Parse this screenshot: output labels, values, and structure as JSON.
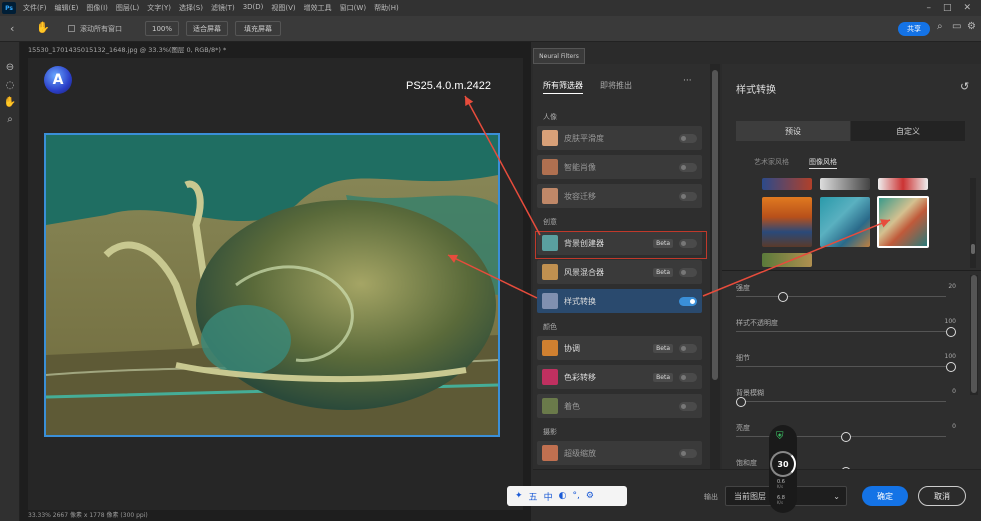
{
  "menu": {
    "ps_icon": "Ps",
    "items": [
      "文件(F)",
      "编辑(E)",
      "图像(I)",
      "图层(L)",
      "文字(Y)",
      "选择(S)",
      "滤镜(T)",
      "3D(D)",
      "视图(V)",
      "增效工具",
      "窗口(W)",
      "帮助(H)"
    ]
  },
  "options": {
    "scroll_all_windows": "滚动所有窗口",
    "zoom": "100%",
    "fit_screen": "适合屏幕",
    "fill_screen": "填充屏幕",
    "share": "共享"
  },
  "document": {
    "tab_title": "15530_1701435015132_1648.jpg @ 33.3%(图层 0, RGB/8*) *",
    "status": "33.33%   2667 像素 x 1778 像素 (300 ppi)"
  },
  "annotation": {
    "version_label": "PS25.4.0.m.2422"
  },
  "panel": {
    "tab_label": "Neural Filters",
    "tabs": [
      "所有筛选器",
      "即将推出"
    ],
    "more_icon": "ellipsis-icon",
    "categories": [
      {
        "label": "人像",
        "filters": [
          {
            "name": "皮肤平滑度",
            "beta": false,
            "on": false
          },
          {
            "name": "智能肖像",
            "beta": false,
            "on": false
          },
          {
            "name": "妆容迁移",
            "beta": false,
            "on": false
          }
        ]
      },
      {
        "label": "创意",
        "filters": [
          {
            "name": "背景创建器",
            "beta": true,
            "on": false
          },
          {
            "name": "风景混合器",
            "beta": true,
            "on": false
          },
          {
            "name": "样式转换",
            "beta": false,
            "on": true
          }
        ]
      },
      {
        "label": "颜色",
        "filters": [
          {
            "name": "协调",
            "beta": true,
            "on": false
          },
          {
            "name": "色彩转移",
            "beta": true,
            "on": false
          },
          {
            "name": "着色",
            "beta": false,
            "on": false
          }
        ]
      },
      {
        "label": "摄影",
        "filters": [
          {
            "name": "超级缩放",
            "beta": false,
            "on": false
          }
        ]
      }
    ],
    "beta_label": "Beta"
  },
  "style_transfer": {
    "title": "样式转换",
    "reset_icon": "reset-icon",
    "seg": [
      "预设",
      "自定义"
    ],
    "subtabs": [
      "艺术家风格",
      "图像风格"
    ],
    "sliders": [
      {
        "label": "强度",
        "value": "20",
        "level": 0.2
      },
      {
        "label": "样式不透明度",
        "value": "100",
        "level": 1.0
      },
      {
        "label": "细节",
        "value": "100",
        "level": 1.0
      },
      {
        "label": "背景模糊",
        "value": "0",
        "level": 0.0
      },
      {
        "label": "亮度",
        "value": "0",
        "level": 0.5
      },
      {
        "label": "饱和度",
        "value": "",
        "level": 0.5
      }
    ]
  },
  "footer": {
    "output_label": "输出",
    "output_value": "当前图层",
    "ok": "确定",
    "cancel": "取消"
  },
  "overlay": {
    "speed_percent": "30",
    "up": "0.6",
    "down": "6.8",
    "unit": "K/s"
  },
  "ime": {
    "items": [
      "五",
      "中"
    ]
  },
  "colors": {
    "accent": "#3a8fd8",
    "toggle_on": "#3a8fd8",
    "highlight_box": "#c0392b",
    "arrow": "#e74c3c"
  }
}
